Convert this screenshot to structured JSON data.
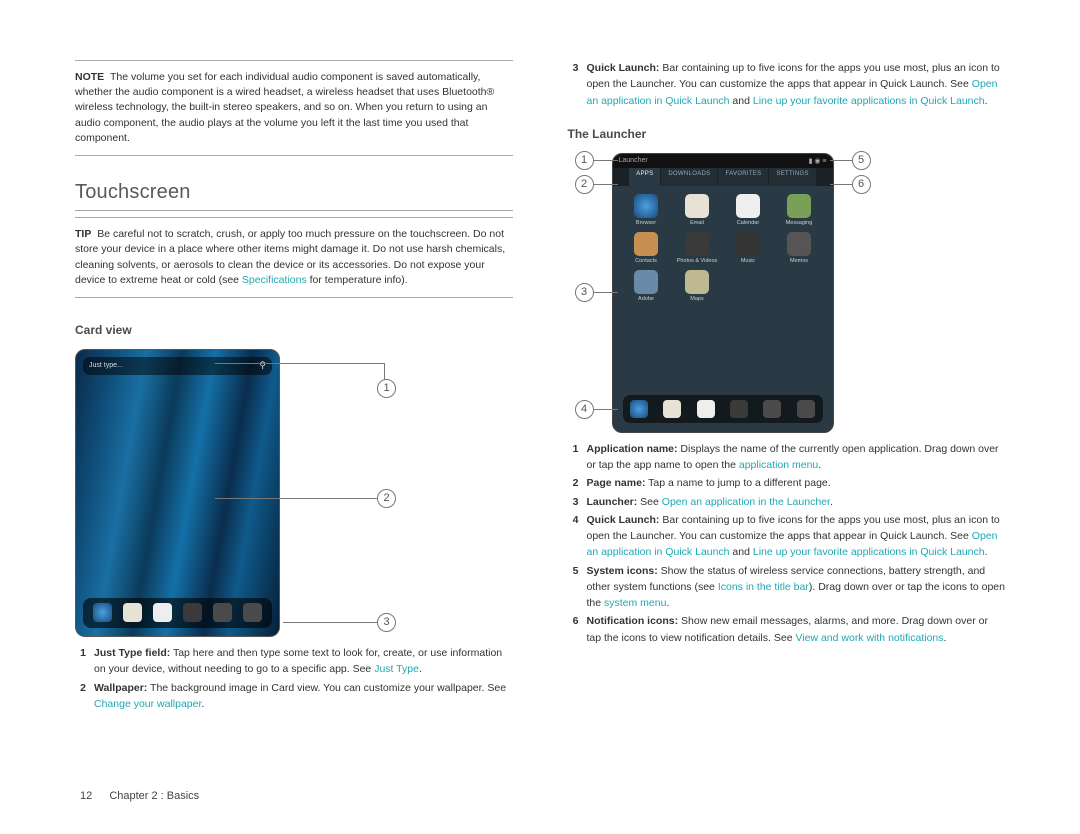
{
  "left": {
    "note": {
      "label": "NOTE",
      "text": "The volume you set for each individual audio component is saved automatically, whether the audio component is a wired headset, a wireless headset that uses Bluetooth® wireless technology, the built-in stereo speakers, and so on. When you return to using an audio component, the audio plays at the volume you left it the last time you used that component."
    },
    "h2": "Touchscreen",
    "tip": {
      "label": "TIP",
      "text_a": "Be careful not to scratch, crush, or apply too much pressure on the touchscreen. Do not store your device in a place where other items might damage it. Do not use harsh chemicals, cleaning solvents, or aerosols to clean the device or its accessories. Do not expose your device to extreme heat or cold (see ",
      "link": "Specifications",
      "text_b": " for temperature info)."
    },
    "h3": "Card view",
    "justtype": "Just type...",
    "cv": {
      "1": {
        "lbl": "Just Type field:",
        "txt_a": " Tap here and then type some text to look for, create, or use information on your device, without needing to go to a specific app. See ",
        "link": "Just Type",
        "txt_b": "."
      },
      "2": {
        "lbl": "Wallpaper:",
        "txt_a": " The background image in Card view. You can customize your wallpaper. See ",
        "link": "Change your wallpaper",
        "txt_b": "."
      }
    }
  },
  "right": {
    "ql3": {
      "lbl": "Quick Launch:",
      "txt_a": " Bar containing up to five icons for the apps you use most, plus an icon to open the Launcher. You can customize the apps that appear in Quick Launch. See ",
      "link1": "Open an application in Quick Launch",
      "mid": " and ",
      "link2": "Line up your favorite applications in Quick Launch",
      "txt_b": "."
    },
    "h3": "The Launcher",
    "title": "Launcher",
    "tabs": {
      "a": "APPS",
      "b": "DOWNLOADS",
      "c": "FAVORITES",
      "d": "SETTINGS"
    },
    "apps": {
      "a": "Browser",
      "b": "Email",
      "c": "Calendar",
      "d": "Messaging",
      "e": "Contacts",
      "f": "Photos & Videos",
      "g": "Music",
      "h": "Memos",
      "i": "Adobe",
      "j": "Maps"
    },
    "list": {
      "1": {
        "lbl": "Application name:",
        "txt_a": " Displays the name of the currently open application. Drag down over or tap the app name to open the ",
        "link": "application menu",
        "txt_b": "."
      },
      "2": {
        "lbl": "Page name:",
        "txt": " Tap a name to jump to a different page."
      },
      "3": {
        "lbl": "Launcher:",
        "txt_a": " See ",
        "link": "Open an application in the Launcher",
        "txt_b": "."
      },
      "4": {
        "lbl": "Quick Launch:",
        "txt_a": " Bar containing up to five icons for the apps you use most, plus an icon to open the Launcher. You can customize the apps that appear in Quick Launch. See ",
        "link1": "Open an application in Quick Launch",
        "mid": " and ",
        "link2": "Line up your favorite applications in Quick Launch",
        "txt_b": "."
      },
      "5": {
        "lbl": "System icons:",
        "txt_a": " Show the status of wireless service connections, battery strength, and other system functions (see ",
        "link1": "Icons in the title bar",
        "mid": "). Drag down over or tap the icons to open the ",
        "link2": "system menu",
        "txt_b": "."
      },
      "6": {
        "lbl": "Notification icons:",
        "txt_a": " Show new email messages, alarms, and more. Drag down over or tap the icons to view notification details. See ",
        "link": "View and work with notifications",
        "txt_b": "."
      }
    }
  },
  "footer": {
    "page": "12",
    "chapter": "Chapter 2 : Basics"
  }
}
